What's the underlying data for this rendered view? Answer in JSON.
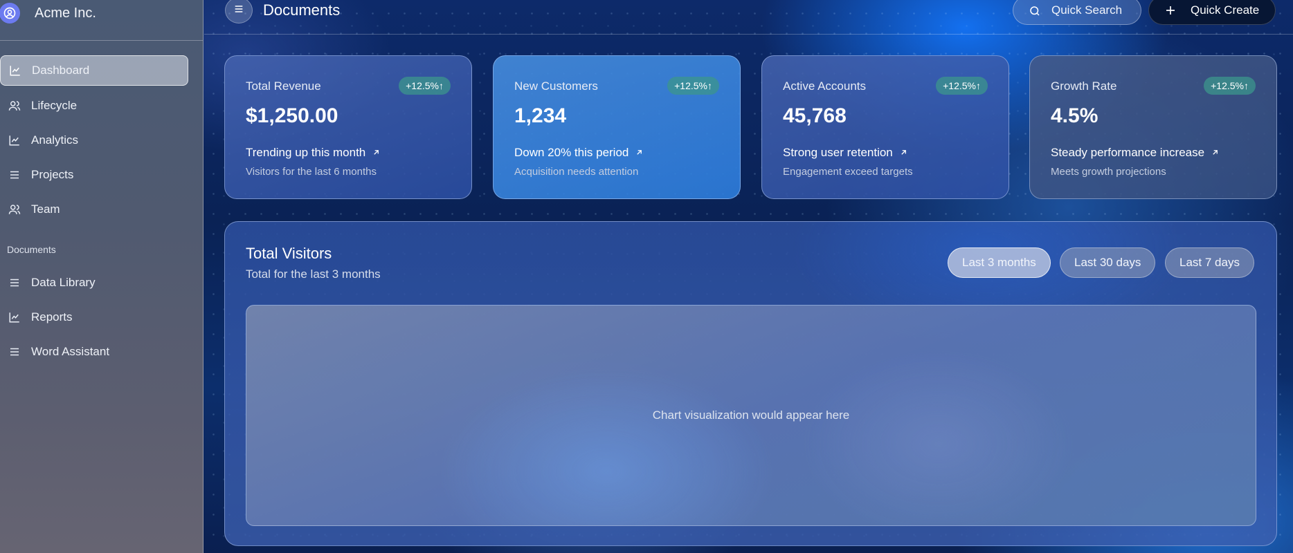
{
  "app": {
    "name": "Acme Inc."
  },
  "sidebar": {
    "items": [
      {
        "label": "Dashboard",
        "icon": "chart-line-icon",
        "active": true
      },
      {
        "label": "Lifecycle",
        "icon": "users-icon"
      },
      {
        "label": "Analytics",
        "icon": "chart-line-icon"
      },
      {
        "label": "Projects",
        "icon": "list-icon"
      },
      {
        "label": "Team",
        "icon": "users-icon"
      }
    ],
    "section_label": "Documents",
    "doc_items": [
      {
        "label": "Data Library",
        "icon": "list-icon"
      },
      {
        "label": "Reports",
        "icon": "chart-line-icon"
      },
      {
        "label": "Word Assistant",
        "icon": "list-icon"
      }
    ]
  },
  "header": {
    "title": "Documents",
    "search_label": "Quick Search",
    "create_label": "Quick Create"
  },
  "cards": [
    {
      "title": "Total Revenue",
      "badge": "+12.5%↑",
      "value": "$1,250.00",
      "trend": "Trending up this month",
      "sub": "Visitors for the last 6 months"
    },
    {
      "title": "New Customers",
      "badge": "+12.5%↑",
      "value": "1,234",
      "trend": "Down 20% this period",
      "sub": "Acquisition needs attention"
    },
    {
      "title": "Active Accounts",
      "badge": "+12.5%↑",
      "value": "45,768",
      "trend": "Strong user retention",
      "sub": "Engagement exceed targets"
    },
    {
      "title": "Growth Rate",
      "badge": "+12.5%↑",
      "value": "4.5%",
      "trend": "Steady performance increase",
      "sub": "Meets growth projections"
    }
  ],
  "visitors": {
    "title": "Total Visitors",
    "subtitle": "Total for the last 3 months",
    "ranges": [
      "Last 3 months",
      "Last 30 days",
      "Last 7 days"
    ],
    "active_range": "Last 3 months",
    "placeholder": "Chart visualization would appear here"
  },
  "colors": {
    "accent_badge": "#3c968c",
    "logo": "#6c7bf0",
    "quick_create_bg": "#071634"
  }
}
